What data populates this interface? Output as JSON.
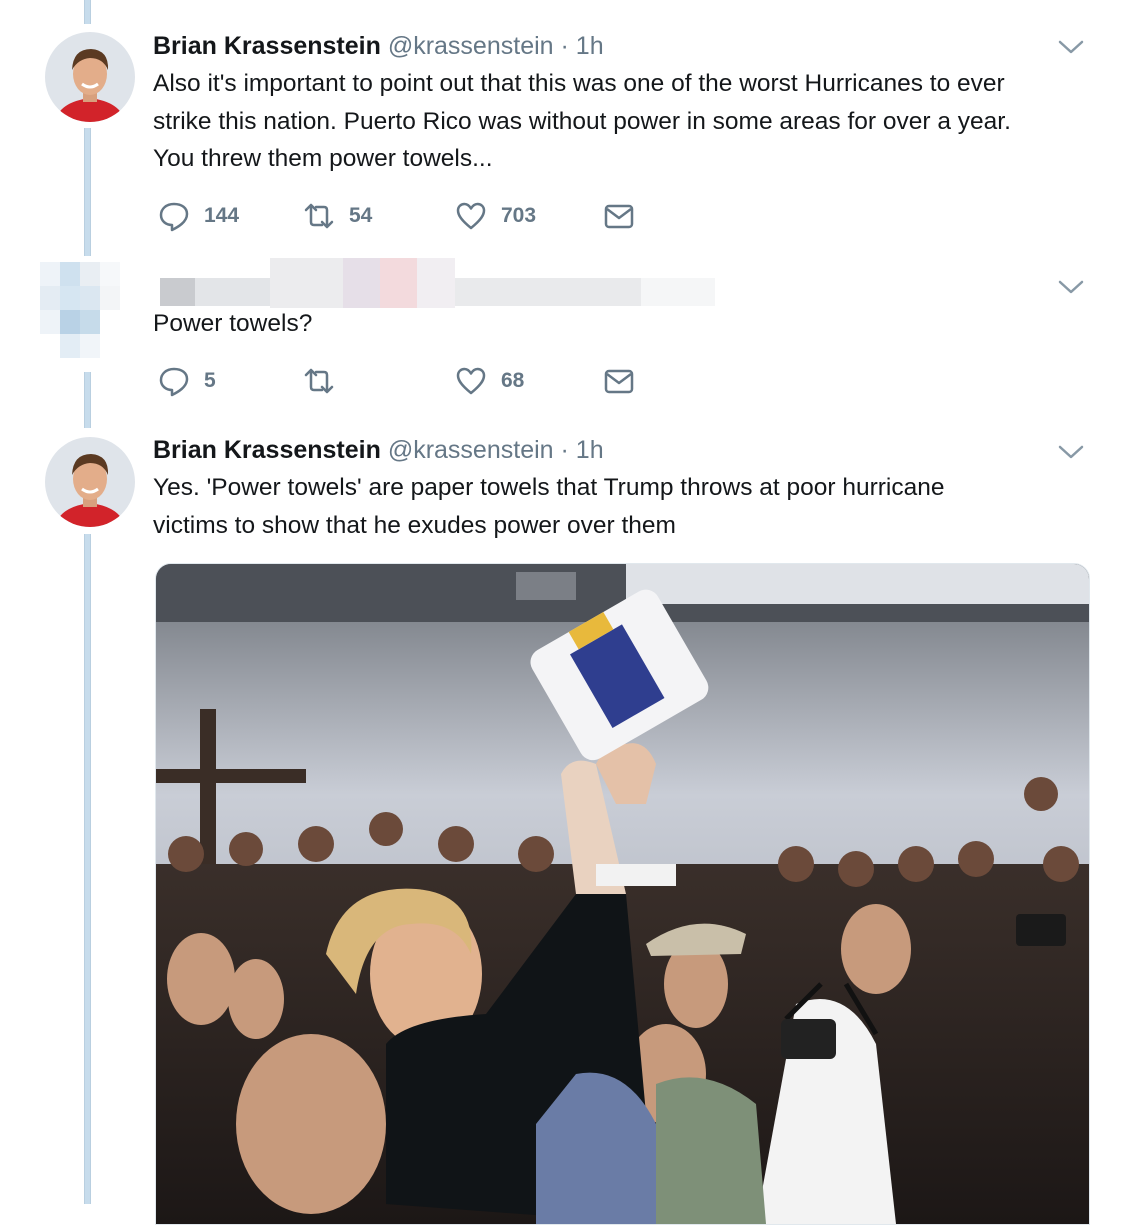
{
  "tweets": [
    {
      "author_name": "Brian Krassenstein",
      "author_handle": "@krassenstein",
      "separator": "·",
      "time": "1h",
      "lines": [
        "Also it's important to point out that this was one of the worst Hurricanes to ever",
        "strike this nation.  Puerto Rico was without power in some areas for over a year.",
        "You threw them power towels..."
      ],
      "reply_count": "144",
      "retweet_count": "54",
      "like_count": "703"
    },
    {
      "author_redacted": true,
      "lines": [
        "Power towels?"
      ],
      "reply_count": "5",
      "retweet_count": "",
      "like_count": "68"
    },
    {
      "author_name": "Brian Krassenstein",
      "author_handle": "@krassenstein",
      "separator": "·",
      "time": "1h",
      "lines": [
        "Yes.  'Power towels' are paper towels that Trump throws at poor hurricane",
        "victims to show that he exudes power over them"
      ],
      "media": "photo"
    }
  ],
  "icons": {
    "reply": "reply-icon",
    "retweet": "retweet-icon",
    "like": "heart-icon",
    "dm": "envelope-icon",
    "menu": "chevron-down-icon"
  },
  "colors": {
    "text": "#14171a",
    "secondary": "#657786",
    "thread_line": "#c7dcec"
  }
}
